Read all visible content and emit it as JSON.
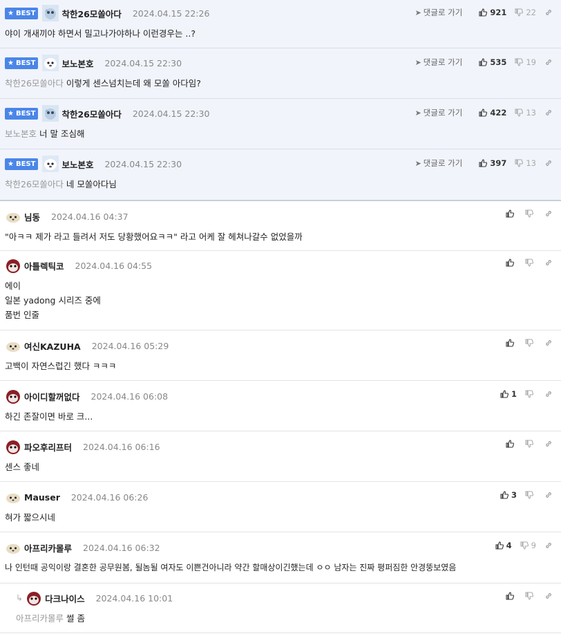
{
  "labels": {
    "best": "BEST",
    "goto": "댓글로 가기"
  },
  "best_comments": [
    {
      "nick": "착한26모쏠아다",
      "date": "2024.04.15 22:26",
      "mention": "",
      "text": "야이 개새끼야 하면서 밀고나가야하나 이런경우는 ..?",
      "up": "921",
      "down": "22",
      "avatar": "fish"
    },
    {
      "nick": "보노본호",
      "date": "2024.04.15 22:30",
      "mention": "착한26모쏠아다",
      "text": "이렇게 센스넘치는데 왜 모쏠 아다임?",
      "up": "535",
      "down": "19",
      "avatar": "seal"
    },
    {
      "nick": "착한26모쏠아다",
      "date": "2024.04.15 22:30",
      "mention": "보노본호",
      "text": "너 말 조심해",
      "up": "422",
      "down": "13",
      "avatar": "fish"
    },
    {
      "nick": "보노본호",
      "date": "2024.04.15 22:30",
      "mention": "착한26모쏠아다",
      "text": "네 모쏠아다님",
      "up": "397",
      "down": "13",
      "avatar": "seal"
    }
  ],
  "comments": [
    {
      "nick": "님동",
      "date": "2024.04.16 04:37",
      "lines": [
        "\"아ㅋㅋ 제가 라고 들려서 저도 당황했어요ㅋㅋ\" 라고 어케 잘 헤쳐나갈수 없었을까"
      ],
      "up": "",
      "down": "",
      "avatar": "dog"
    },
    {
      "nick": "아틀렉틱코",
      "date": "2024.04.16 04:55",
      "lines": [
        "에이",
        "일본 yadong 시리즈 중에",
        "품번 인줄"
      ],
      "up": "",
      "down": "",
      "avatar": "panda"
    },
    {
      "nick": "여신KAZUHA",
      "date": "2024.04.16 05:29",
      "lines": [
        "고백이 자연스럽긴 했다 ㅋㅋㅋ"
      ],
      "up": "",
      "down": "",
      "avatar": "dog"
    },
    {
      "nick": "아이디할꺼없다",
      "date": "2024.04.16 06:08",
      "lines": [
        "하긴 존잘이면 바로 크..."
      ],
      "up": "1",
      "down": "",
      "avatar": "panda"
    },
    {
      "nick": "파오후리프터",
      "date": "2024.04.16 06:16",
      "lines": [
        "센스 좋네"
      ],
      "up": "",
      "down": "",
      "avatar": "panda"
    },
    {
      "nick": "Mauser",
      "date": "2024.04.16 06:26",
      "lines": [
        "혀가 짧으시네"
      ],
      "up": "3",
      "down": "",
      "avatar": "dog"
    },
    {
      "nick": "아프리카몰루",
      "date": "2024.04.16 06:32",
      "lines": [
        "나 인턴때 공익이랑 결혼한 공무원봄, 될놈될 여자도 이쁜건아니라 약간 할매상이긴했는데 ㅇㅇ 남자는 진짜 평퍼짐한 안경뚱보였음"
      ],
      "up": "4",
      "down": "9",
      "avatar": "dog"
    }
  ],
  "reply": {
    "nick": "다크나이스",
    "date": "2024.04.16 10:01",
    "mention": "아프리카몰루",
    "text": "썰 좀",
    "up": "",
    "down": "",
    "avatar": "panda"
  },
  "colors": {
    "best_bg": "#f1f4fb",
    "badge": "#4a86e8",
    "divider": "#e3e3e3"
  }
}
